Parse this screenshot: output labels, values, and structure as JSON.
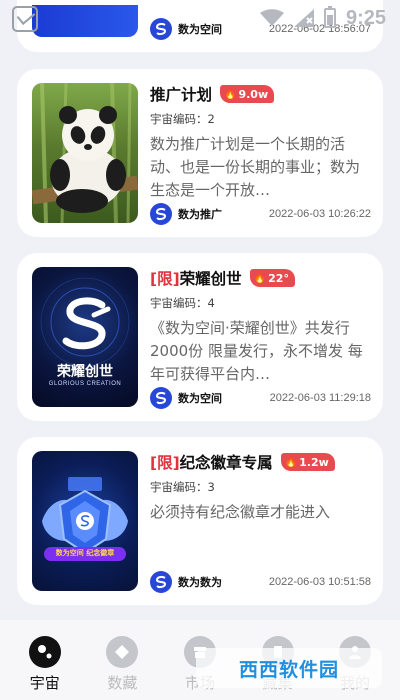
{
  "status_bar": {
    "time": "9:25"
  },
  "cards": [
    {
      "id": "top",
      "brand": "数为空间",
      "timestamp": "2022-06-02 18:56:07"
    },
    {
      "id": "card1",
      "limited_tag": "",
      "title": "推广计划",
      "heat": "9.0w",
      "code": "宇宙编码：2",
      "description": "数为推广计划是一个长期的活动、也是一份长期的事业；数为生态是一个开放…",
      "brand": "数为推广",
      "timestamp": "2022-06-03 10:26:22"
    },
    {
      "id": "card2",
      "limited_tag": "[限]",
      "title": "荣耀创世",
      "heat": "22°",
      "code": "宇宙编码：4",
      "description": "《数为空间·荣耀创世》共发行2000份 限量发行，永不增发 每年可获得平台内…",
      "brand": "数为空间",
      "timestamp": "2022-06-03 11:29:18",
      "thumb_caption": "荣耀创世",
      "thumb_subcaption": "GLORIOUS CREATION"
    },
    {
      "id": "card3",
      "limited_tag": "[限]",
      "title": "纪念徽章专属",
      "heat": "1.2w",
      "code": "宇宙编码：3",
      "description": "必须持有纪念徽章才能进入",
      "brand": "数为数为",
      "timestamp": "2022-06-03 10:51:58",
      "thumb_caption": "数为空间 纪念徽章"
    }
  ],
  "tabs": [
    {
      "label": "宇宙",
      "active": true
    },
    {
      "label": "数藏",
      "active": false
    },
    {
      "label": "市场",
      "active": false
    },
    {
      "label": "藏集",
      "active": false
    },
    {
      "label": "我的",
      "active": false
    }
  ],
  "watermark": "西西软件园",
  "colors": {
    "accent_blue": "#2748d6",
    "heat_red": "#e84a4f",
    "limited_red": "#e0313c",
    "background": "#f0f1f6"
  }
}
